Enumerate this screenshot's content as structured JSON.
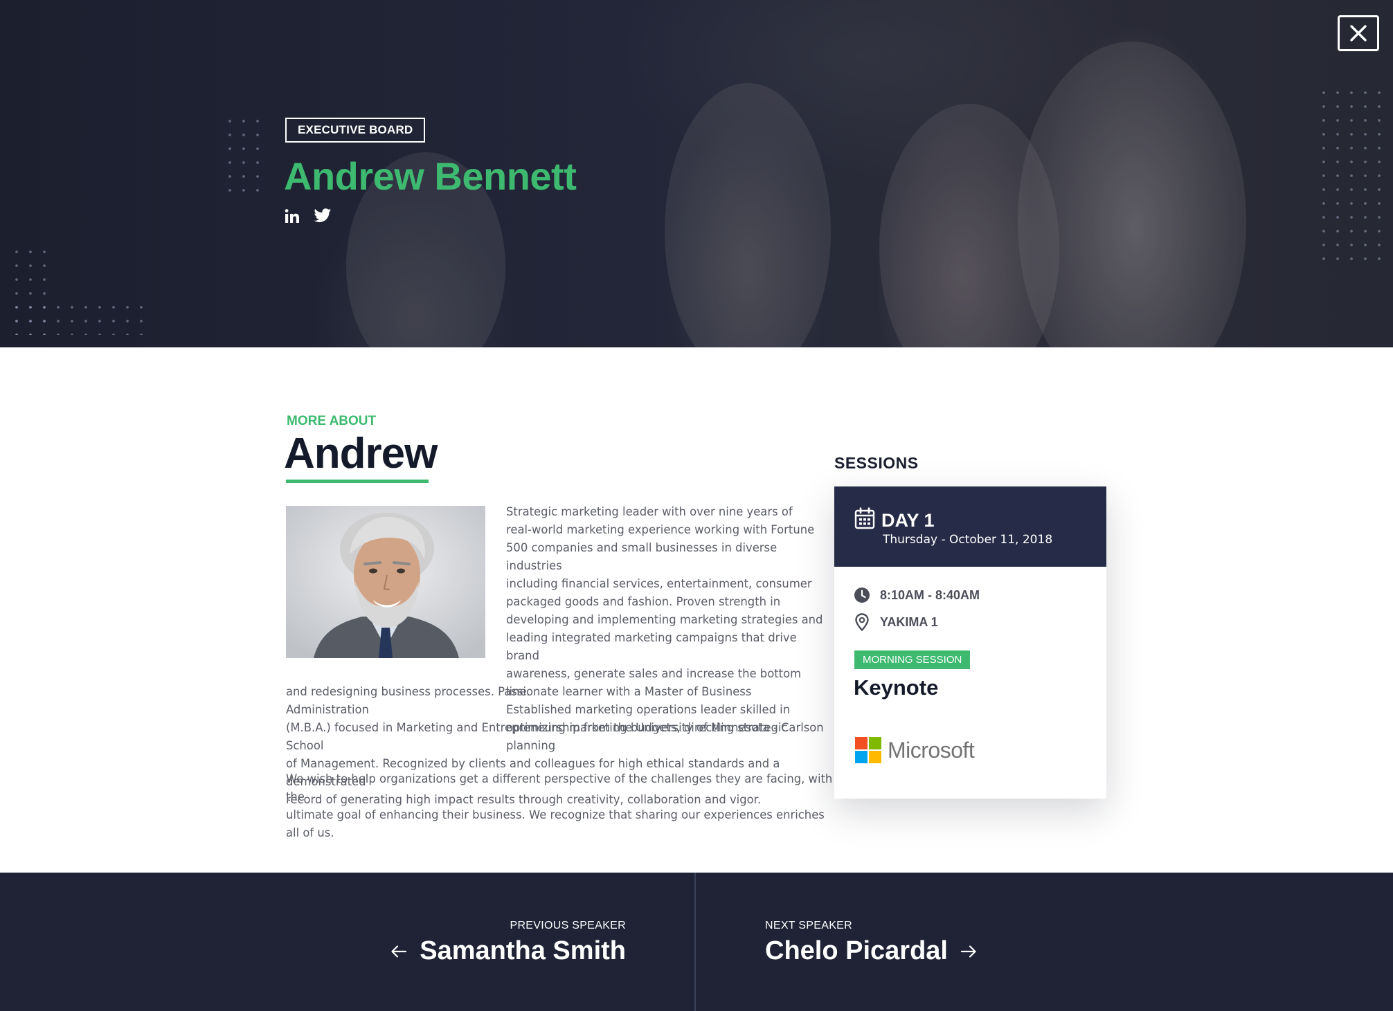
{
  "hero": {
    "category_badge": "EXECUTIVE BOARD",
    "speaker_name": "Andrew Bennett",
    "social": [
      {
        "icon": "linkedin-icon"
      },
      {
        "icon": "twitter-icon"
      }
    ],
    "close_icon": "close-icon"
  },
  "about": {
    "eyebrow": "MORE ABOUT",
    "first_name": "Andrew",
    "photo_icon": "speaker-portrait",
    "bio_wrap_lines": [
      "Strategic marketing leader with over nine years of",
      "real-world marketing experience working with Fortune",
      "500 companies and small businesses in diverse industries",
      "including financial services, entertainment, consumer",
      "packaged goods and fashion. Proven strength in",
      "developing and implementing marketing strategies and",
      "leading integrated marketing campaigns that drive brand",
      "awareness, generate sales and increase the bottom line.",
      "Established marketing operations leader skilled in",
      "optimizing marketing budgets, directing strategic planning"
    ],
    "bio_full_lines": [
      "and redesigning business processes. Passionate learner with a Master of Business Administration",
      "(M.B.A.) focused in Marketing and Entrepreneurship from the University of Minnesota - Carlson School",
      "of Management. Recognized by clients and colleagues for high ethical standards and a demonstrated",
      "record of generating high impact results through creativity, collaboration and vigor."
    ],
    "bio_paragraph_2_lines": [
      "We wish to help organizations get a different perspective of the challenges they are facing, with the",
      "ultimate goal of enhancing their business. We recognize that sharing our experiences enriches all of us."
    ]
  },
  "sessions": {
    "heading": "SESSIONS",
    "day": "DAY 1",
    "date": "Thursday - October 11, 2018",
    "time": "8:10AM - 8:40AM",
    "location": "YAKIMA 1",
    "tag": "MORNING SESSION",
    "title": "Keynote",
    "sponsor": "Microsoft",
    "icons": {
      "calendar": "calendar-icon",
      "clock": "clock-icon",
      "pin": "location-pin-icon",
      "logo": "microsoft-logo"
    },
    "sponsor_colors": [
      "#f25022",
      "#7fba00",
      "#00a4ef",
      "#ffb900"
    ]
  },
  "footer": {
    "prev_caption": "PREVIOUS SPEAKER",
    "prev_name": "Samantha Smith",
    "next_caption": "NEXT SPEAKER",
    "next_name": "Chelo Picardal",
    "icons": {
      "prev": "arrow-left-icon",
      "next": "arrow-right-icon"
    }
  },
  "colors": {
    "accent_green": "#3dba6f",
    "hero_dark": "#1d2132",
    "card_header": "#262c48",
    "footer_bg": "#1f2335"
  }
}
